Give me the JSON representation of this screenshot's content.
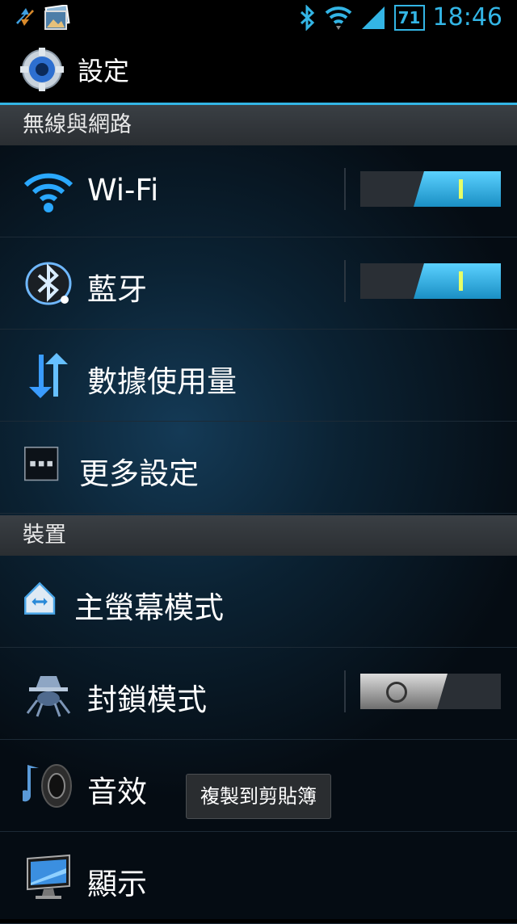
{
  "status_bar": {
    "left_icons": [
      "sync-arrows-icon",
      "gallery-icon"
    ],
    "right_icons": [
      "bluetooth-icon",
      "wifi-icon",
      "signal-icon"
    ],
    "battery_level": "71",
    "time": "18:46"
  },
  "action_bar": {
    "title": "設定"
  },
  "sections": [
    {
      "header": "無線與網路",
      "items": [
        {
          "label": "Wi-Fi",
          "icon": "wifi-icon",
          "toggle": "on"
        },
        {
          "label": "藍牙",
          "icon": "bluetooth-icon",
          "toggle": "on"
        },
        {
          "label": "數據使用量",
          "icon": "data-usage-icon"
        },
        {
          "label": "更多設定",
          "icon": "more-icon"
        }
      ]
    },
    {
      "header": "裝置",
      "items": [
        {
          "label": "主螢幕模式",
          "icon": "home-icon"
        },
        {
          "label": "封鎖模式",
          "icon": "block-mode-icon",
          "toggle": "off"
        },
        {
          "label": "音效",
          "icon": "speaker-icon"
        },
        {
          "label": "顯示",
          "icon": "display-icon"
        }
      ]
    }
  ],
  "toast": "複製到剪貼簿",
  "colors": {
    "accent": "#33b5e5",
    "switch_on": "#1a8fc4"
  }
}
